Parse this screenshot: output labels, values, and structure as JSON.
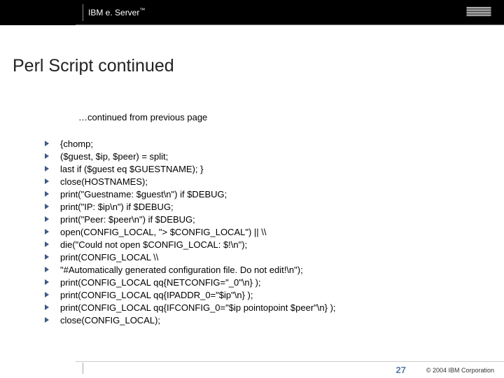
{
  "header": {
    "brand_prefix": "IBM e. Server",
    "trademark": "™"
  },
  "title": "Perl Script continued",
  "subtitle": "…continued from previous page",
  "code_lines": [
    "{chomp;",
    "($guest, $ip, $peer) = split;",
    "last if ($guest eq $GUESTNAME); }",
    "close(HOSTNAMES);",
    "print(\"Guestname: $guest\\n\") if $DEBUG;",
    "print(\"IP: $ip\\n\") if $DEBUG;",
    "print(\"Peer: $peer\\n\") if $DEBUG;",
    "open(CONFIG_LOCAL, \"> $CONFIG_LOCAL\") || \\\\",
    "die(\"Could not open $CONFIG_LOCAL: $!\\n\");",
    "print(CONFIG_LOCAL \\\\",
    "\"#Automatically generated configuration file. Do not edit!\\n\");",
    "print(CONFIG_LOCAL qq{NETCONFIG=\"_0\"\\n} );",
    "print(CONFIG_LOCAL qq{IPADDR_0=\"$ip\"\\n} );",
    "print(CONFIG_LOCAL qq{IFCONFIG_0=\"$ip pointopoint $peer\"\\n} );",
    "close(CONFIG_LOCAL);"
  ],
  "footer": {
    "slide_number": "27",
    "copyright": "© 2004 IBM Corporation"
  }
}
